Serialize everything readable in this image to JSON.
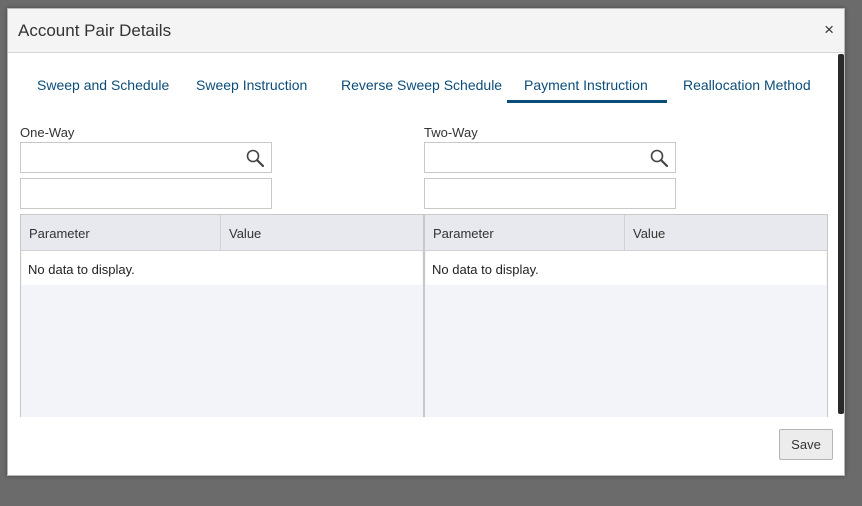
{
  "dialog": {
    "title": "Account Pair Details",
    "close_glyph": "×"
  },
  "tabs": [
    {
      "label": "Sweep and Schedule",
      "active": false
    },
    {
      "label": "Sweep Instruction",
      "active": false
    },
    {
      "label": "Reverse Sweep Schedule",
      "active": false
    },
    {
      "label": "Payment Instruction",
      "active": true
    },
    {
      "label": "Reallocation Method",
      "active": false
    }
  ],
  "one_way": {
    "label": "One-Way",
    "search_value": "",
    "second_value": "",
    "grid": {
      "columns": [
        "Parameter",
        "Value"
      ],
      "empty_text": "No data to display."
    }
  },
  "two_way": {
    "label": "Two-Way",
    "search_value": "",
    "second_value": "",
    "grid": {
      "columns": [
        "Parameter",
        "Value"
      ],
      "empty_text": "No data to display."
    }
  },
  "footer": {
    "save_label": "Save"
  },
  "icons": {
    "search": "search-icon",
    "close": "close-icon"
  },
  "colors": {
    "tab_text": "#0b4d7a",
    "active_underline": "#0b4d7a",
    "overlay": "#6b6b6b"
  }
}
